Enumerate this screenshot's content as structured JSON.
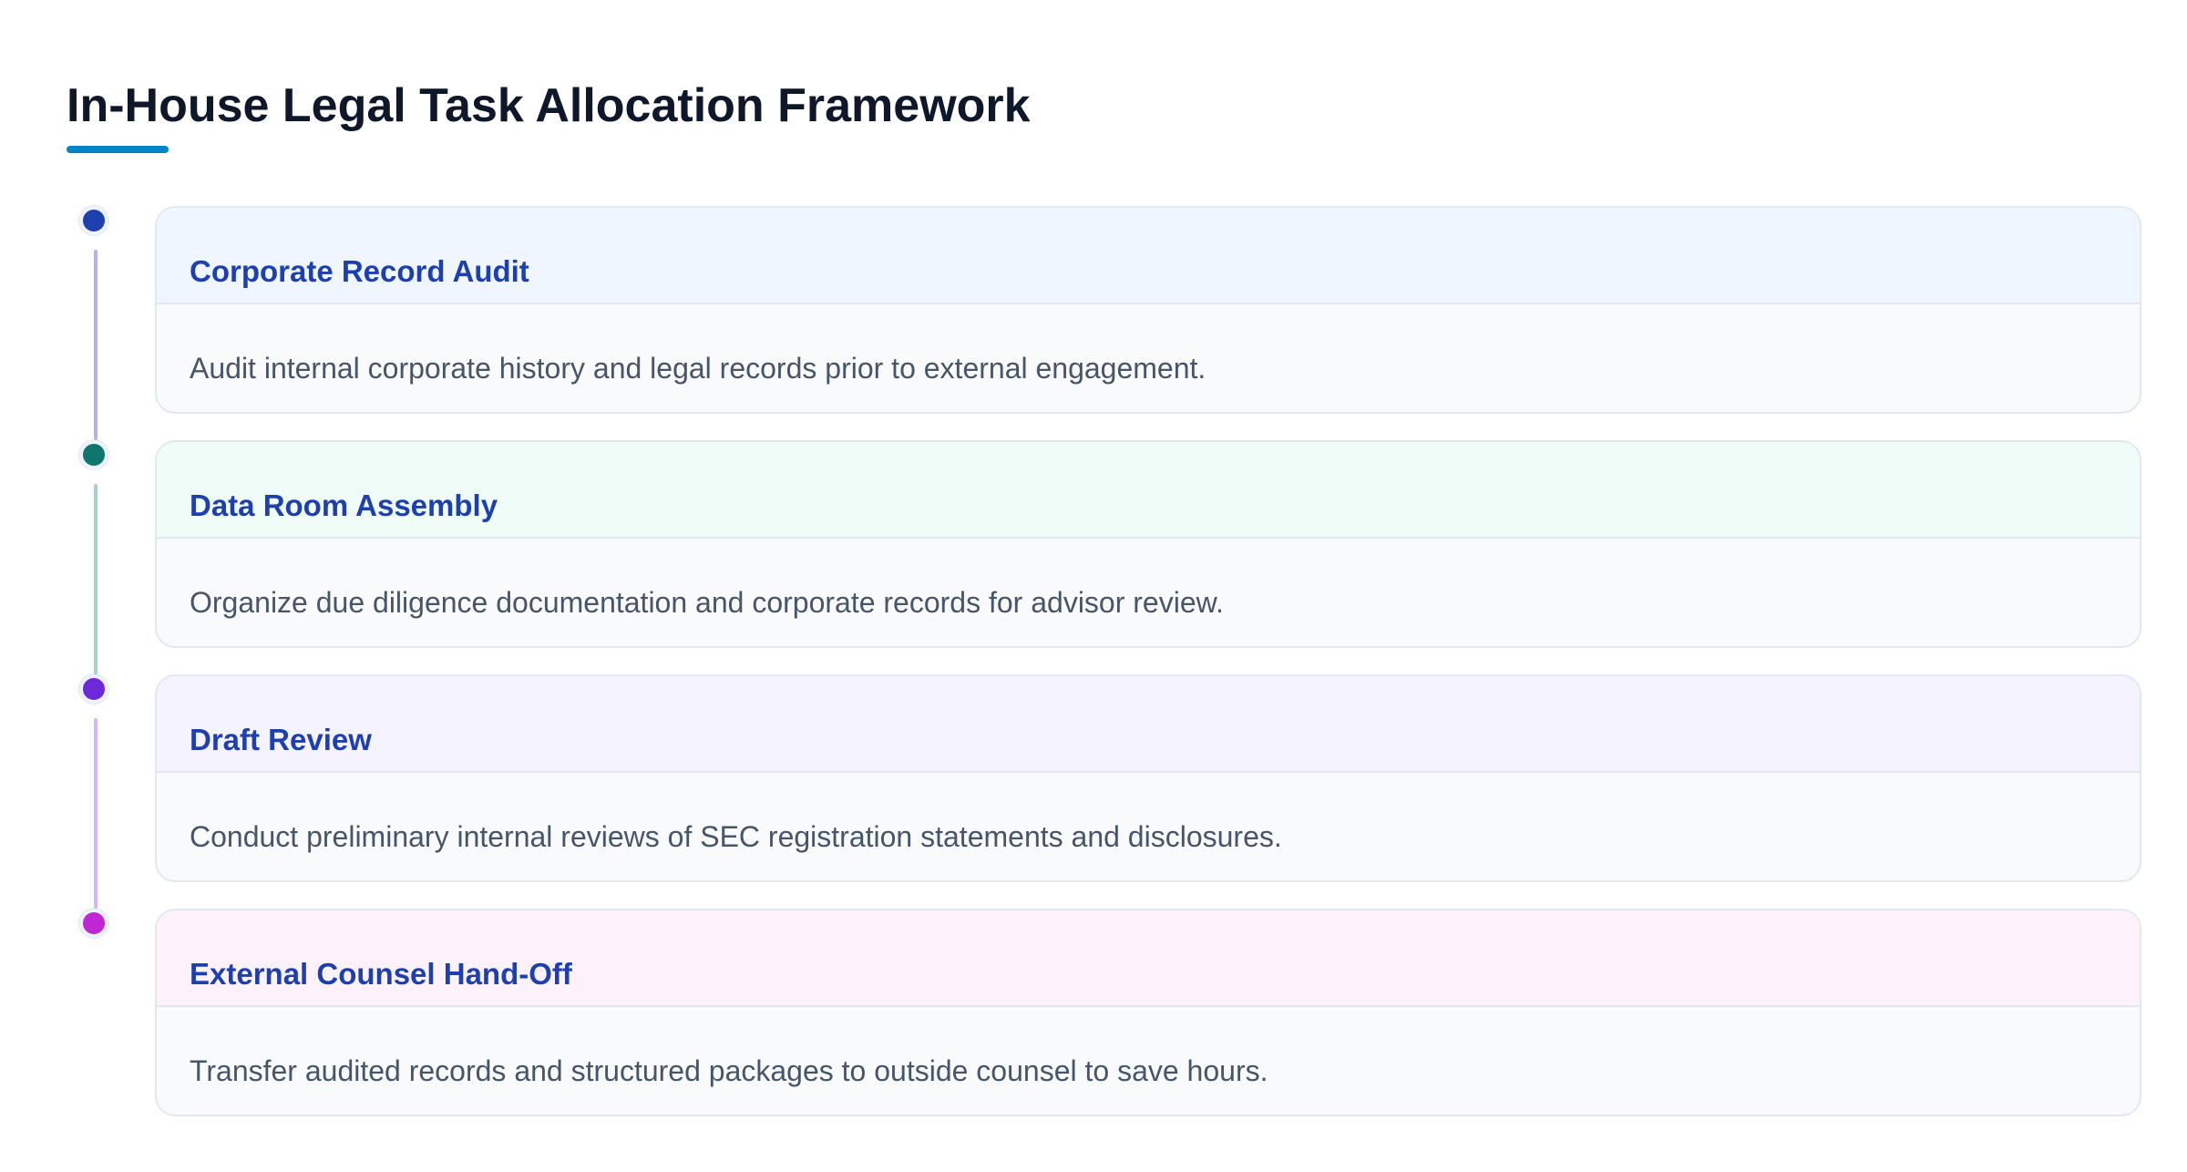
{
  "header": {
    "title": "In-House Legal Task Allocation Framework",
    "accent_color": "#0284c7"
  },
  "steps": [
    {
      "title": "Corporate Record Audit",
      "description": "Audit internal corporate history and legal records prior to external engagement.",
      "node_color": "#1e40af",
      "connector_color": "#b4b2ec",
      "header_color": "#eff6ff"
    },
    {
      "title": "Data Room Assembly",
      "description": "Organize due diligence documentation and corporate records for advisor review.",
      "node_color": "#0f766e",
      "connector_color": "#a7d3cb",
      "header_color": "#effcf8"
    },
    {
      "title": "Draft Review",
      "description": "Conduct preliminary internal reviews of SEC registration statements and disclosures.",
      "node_color": "#6d28d9",
      "connector_color": "#d5b6f7",
      "header_color": "#f5f3ff"
    },
    {
      "title": "External Counsel Hand-Off",
      "description": "Transfer audited records and structured packages to outside counsel to save hours.",
      "node_color": "#c026d3",
      "connector_color": "",
      "header_color": "#fdf2fc"
    }
  ]
}
